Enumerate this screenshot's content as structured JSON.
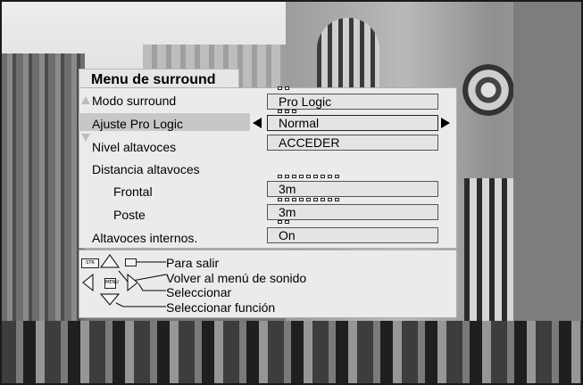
{
  "menu": {
    "title": "Menu de surround",
    "rows": [
      {
        "label": "Modo surround",
        "value": "Pro Logic"
      },
      {
        "label": "Ajuste Pro Logic",
        "value": "Normal"
      },
      {
        "label": "Nivel altavoces",
        "value": "ACCEDER"
      },
      {
        "label": "Distancia altavoces",
        "value": ""
      },
      {
        "label": "Frontal",
        "value": "3m"
      },
      {
        "label": "Poste",
        "value": "3m"
      },
      {
        "label": "Altavoces internos.",
        "value": "On"
      }
    ]
  },
  "help": {
    "exit_key": "STR",
    "menu_key": "MENU",
    "exit": "Para salir",
    "back": "Volver al menú de sonido",
    "select": "Seleccionar",
    "select_function": "Seleccionar función"
  },
  "colors": {
    "panel_bg": "#ebebeb",
    "highlight": "#c7c7c7"
  }
}
